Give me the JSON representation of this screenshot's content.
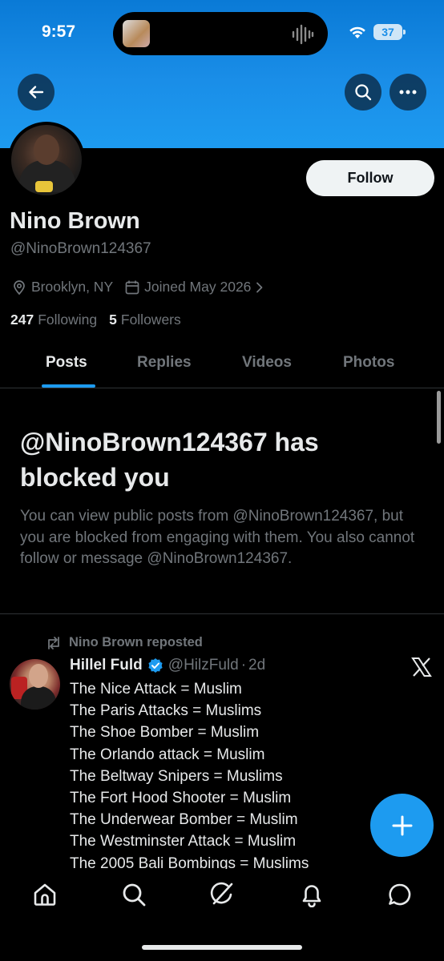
{
  "status_bar": {
    "time": "9:57",
    "battery": "37"
  },
  "header": {
    "back_icon": "arrow-left-icon",
    "search_icon": "search-icon",
    "more_icon": "more-icon"
  },
  "profile": {
    "name": "Nino Brown",
    "handle": "@NinoBrown124367",
    "location": "Brooklyn, NY",
    "joined": "Joined May 2026",
    "following_count": "247",
    "following_label": "Following",
    "followers_count": "5",
    "followers_label": "Followers",
    "follow_label": "Follow"
  },
  "tabs": [
    {
      "label": "Posts",
      "active": true
    },
    {
      "label": "Replies",
      "active": false
    },
    {
      "label": "Videos",
      "active": false
    },
    {
      "label": "Photos",
      "active": false
    }
  ],
  "blocked": {
    "title": "@NinoBrown124367 has blocked you",
    "body": "You can view public posts from @NinoBrown124367, but you are blocked from engaging with them. You also cannot follow or message @NinoBrown124367."
  },
  "post": {
    "repost_label": "Nino Brown reposted",
    "author": "Hillel Fuld",
    "handle": "@HilzFuld",
    "dot": "·",
    "time": "2d",
    "lines": [
      "The Nice Attack = Muslim",
      "The Paris Attacks = Muslims",
      "The Shoe Bomber = Muslim",
      "The Orlando attack = Muslim",
      "The Beltway Snipers = Muslims",
      "The Fort Hood Shooter = Muslim",
      "The Underwear Bomber = Muslim",
      "The Westminster Attack = Muslim",
      "The 2005 Bali Bombings = Muslims"
    ]
  },
  "colors": {
    "accent": "#1d9bf0",
    "background": "#000000",
    "muted": "#71767b",
    "text": "#e7e9ea"
  },
  "nav": [
    "home-icon",
    "search-icon",
    "grok-icon",
    "notifications-icon",
    "messages-icon"
  ]
}
